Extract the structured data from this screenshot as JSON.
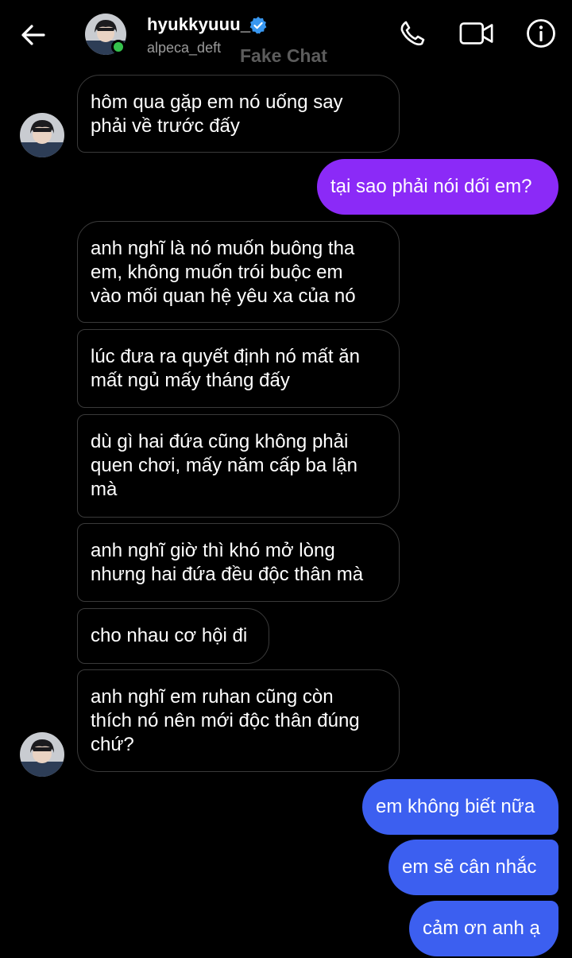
{
  "header": {
    "name": "hyukkyuuu_",
    "handle": "alpeca_deft",
    "watermark": "Fake Chat",
    "icons": [
      "back-arrow-icon",
      "verified-badge-icon",
      "phone-icon",
      "video-camera-icon",
      "info-icon"
    ]
  },
  "colors": {
    "background": "#000000",
    "received_border": "#3a3a3a",
    "sent_purple": "#8b2af7",
    "sent_blue": "#3c5ff0",
    "online": "#35c24d",
    "verified": "#3897f0"
  },
  "messages": [
    {
      "from": "them",
      "text": "hôm qua gặp em nó uống say\nphải về trước đấy"
    },
    {
      "from": "me",
      "text": "tại sao phải nói dối em?"
    },
    {
      "from": "them",
      "text": "anh nghĩ là nó muốn buông tha\nem, không muốn trói buộc em\nvào mối quan hệ yêu xa của nó"
    },
    {
      "from": "them",
      "text": "lúc đưa ra quyết định nó mất ăn\nmất ngủ mấy tháng đấy"
    },
    {
      "from": "them",
      "text": "dù gì hai đứa cũng không phải\nquen chơi, mấy năm cấp ba lận\nmà"
    },
    {
      "from": "them",
      "text": "anh nghĩ giờ thì khó mở lòng\nnhưng hai đứa đều độc thân mà"
    },
    {
      "from": "them",
      "text": "cho nhau cơ hội đi"
    },
    {
      "from": "them",
      "text": "anh nghĩ em ruhan cũng còn\nthích nó nên mới độc thân đúng\nchứ?"
    },
    {
      "from": "me",
      "text": "em không biết nữa"
    },
    {
      "from": "me",
      "text": "em sẽ cân nhắc"
    },
    {
      "from": "me",
      "text": "cảm ơn anh ạ"
    }
  ]
}
